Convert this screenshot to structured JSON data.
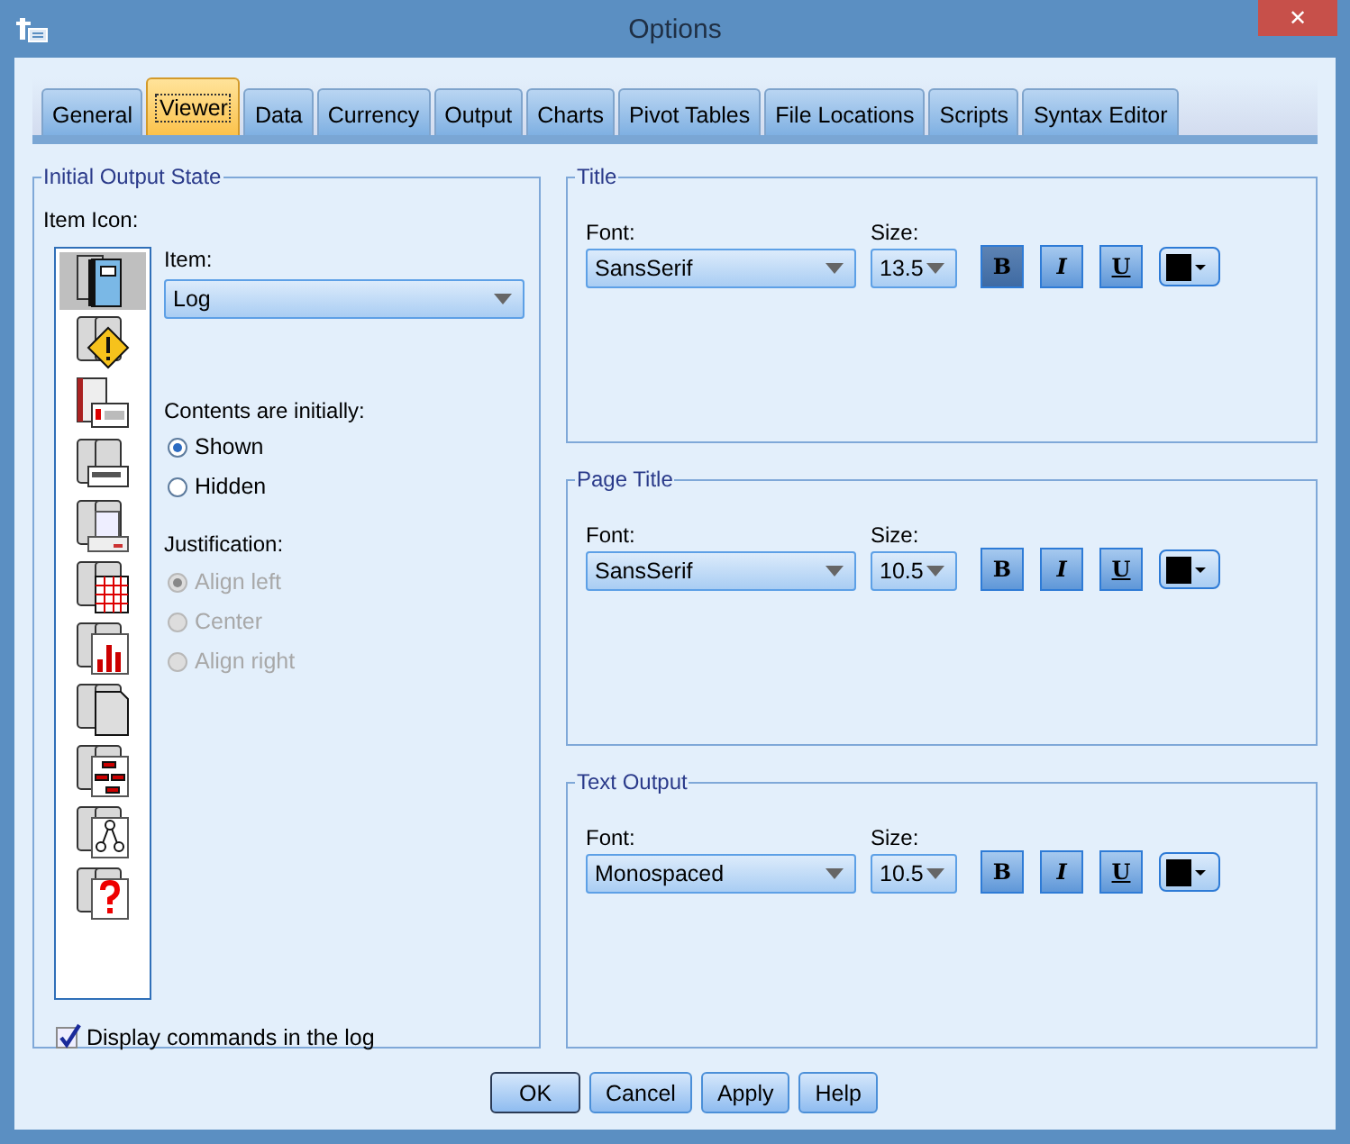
{
  "window": {
    "title": "Options",
    "close": "✕"
  },
  "tabs": [
    {
      "label": "General",
      "selected": false
    },
    {
      "label": "Viewer",
      "selected": true
    },
    {
      "label": "Data",
      "selected": false
    },
    {
      "label": "Currency",
      "selected": false
    },
    {
      "label": "Output",
      "selected": false
    },
    {
      "label": "Charts",
      "selected": false
    },
    {
      "label": "Pivot Tables",
      "selected": false
    },
    {
      "label": "File Locations",
      "selected": false
    },
    {
      "label": "Scripts",
      "selected": false
    },
    {
      "label": "Syntax Editor",
      "selected": false
    }
  ],
  "initial_output_state": {
    "legend": "Initial Output State",
    "icon_label": "Item Icon:",
    "item_icons": [
      {
        "selected": true
      },
      {
        "selected": false
      },
      {
        "selected": false
      },
      {
        "selected": false
      },
      {
        "selected": false
      },
      {
        "selected": false
      },
      {
        "selected": false
      },
      {
        "selected": false
      },
      {
        "selected": false
      },
      {
        "selected": false
      },
      {
        "selected": false
      }
    ],
    "item_label": "Item:",
    "item_value": "Log",
    "contents_label": "Contents are initially:",
    "contents": [
      {
        "label": "Shown",
        "selected": true,
        "disabled": false
      },
      {
        "label": "Hidden",
        "selected": false,
        "disabled": false
      }
    ],
    "justification_label": "Justification:",
    "justification": [
      {
        "label": "Align left",
        "selected": true,
        "disabled": true
      },
      {
        "label": "Center",
        "selected": false,
        "disabled": true
      },
      {
        "label": "Align right",
        "selected": false,
        "disabled": true
      }
    ],
    "display_commands": {
      "label": "Display commands in the log",
      "checked": true
    }
  },
  "font_groups": [
    {
      "legend": "Title",
      "font_label": "Font:",
      "font": "SansSerif",
      "size_label": "Size:",
      "size": "13.5",
      "styles": [
        {
          "kind": "bold",
          "label": "B",
          "pressed": true
        },
        {
          "kind": "italic",
          "label": "I",
          "pressed": false
        },
        {
          "kind": "underline",
          "label": "U",
          "pressed": false
        }
      ],
      "color": "#000000"
    },
    {
      "legend": "Page Title",
      "font_label": "Font:",
      "font": "SansSerif",
      "size_label": "Size:",
      "size": "10.5",
      "styles": [
        {
          "kind": "bold",
          "label": "B",
          "pressed": false
        },
        {
          "kind": "italic",
          "label": "I",
          "pressed": false
        },
        {
          "kind": "underline",
          "label": "U",
          "pressed": false
        }
      ],
      "color": "#000000"
    },
    {
      "legend": "Text Output",
      "font_label": "Font:",
      "font": "Monospaced",
      "size_label": "Size:",
      "size": "10.5",
      "styles": [
        {
          "kind": "bold",
          "label": "B",
          "pressed": false
        },
        {
          "kind": "italic",
          "label": "I",
          "pressed": false
        },
        {
          "kind": "underline",
          "label": "U",
          "pressed": false
        }
      ],
      "color": "#000000"
    }
  ],
  "buttons": [
    {
      "label": "OK",
      "default": true
    },
    {
      "label": "Cancel",
      "default": false
    },
    {
      "label": "Apply",
      "default": false
    },
    {
      "label": "Help",
      "default": false
    }
  ]
}
